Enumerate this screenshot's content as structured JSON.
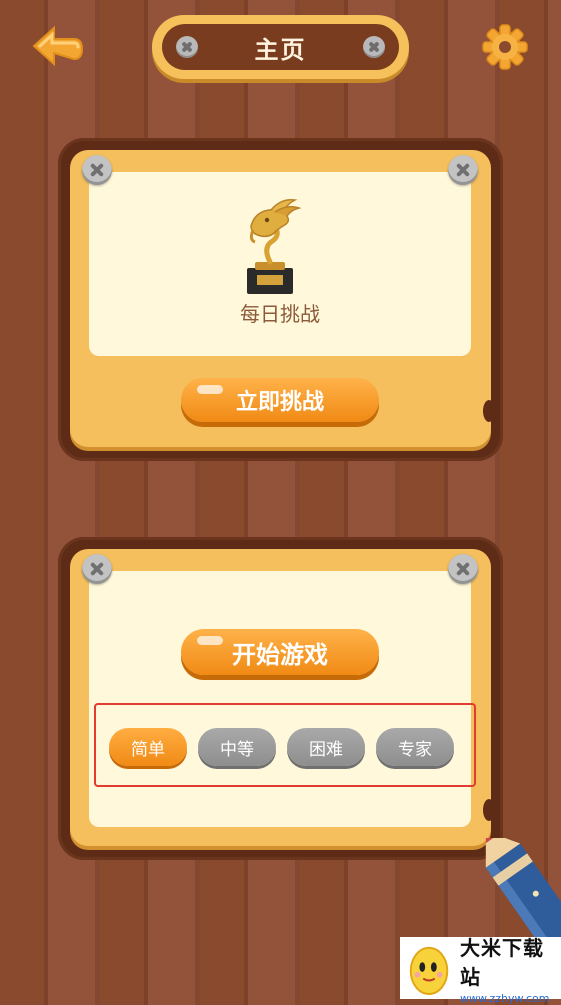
{
  "header": {
    "title": "主页",
    "back_icon": "back-arrow-icon",
    "settings_icon": "gear-icon"
  },
  "daily_challenge": {
    "trophy_icon": "goat-trophy-icon",
    "label": "每日挑战",
    "button_label": "立即挑战"
  },
  "game_panel": {
    "start_label": "开始游戏",
    "difficulties": [
      {
        "label": "简单",
        "selected": true
      },
      {
        "label": "中等",
        "selected": false
      },
      {
        "label": "困难",
        "selected": false
      },
      {
        "label": "专家",
        "selected": false
      }
    ]
  },
  "watermark": {
    "title": "大米下载站",
    "url": "www.zzhyw.com"
  },
  "colors": {
    "accent_orange": "#f08a14",
    "panel_yellow": "#f5bf5e",
    "wood_brown": "#8a4a2e",
    "selection_box": "#e23b2f"
  }
}
